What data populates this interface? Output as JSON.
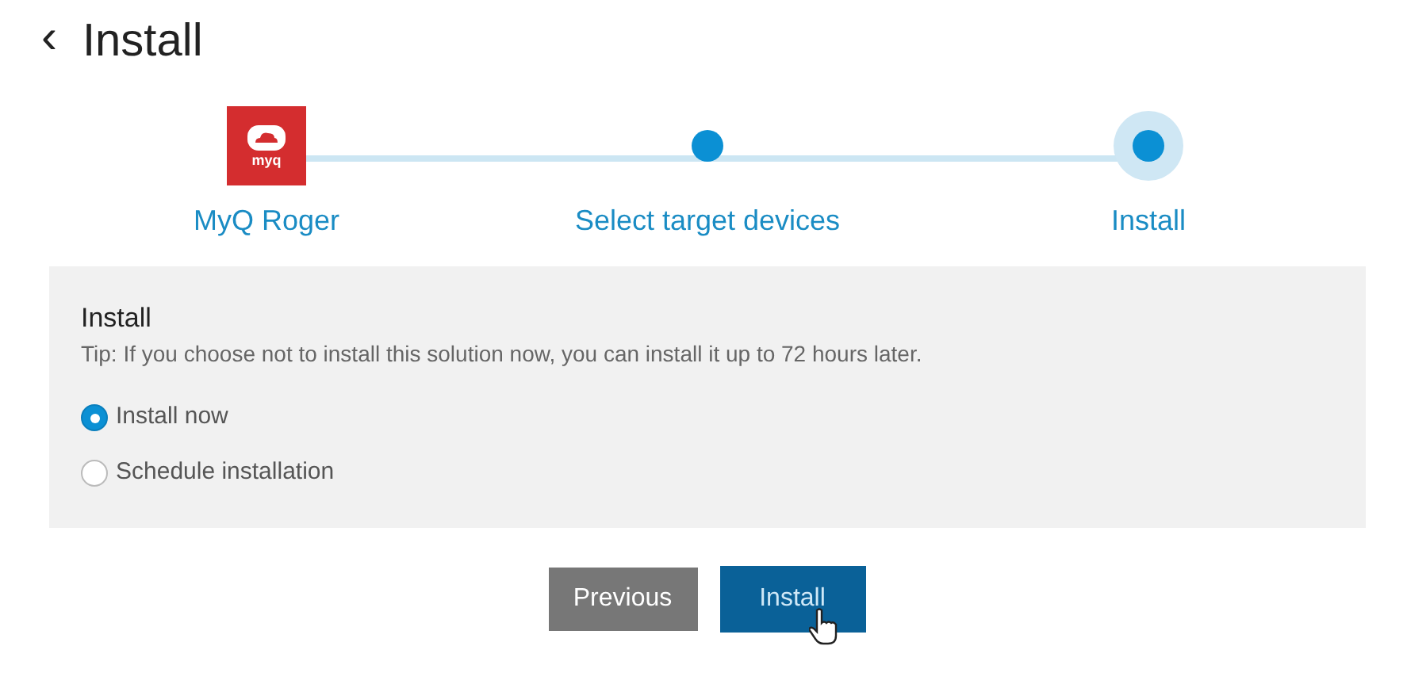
{
  "header": {
    "back_icon": "‹",
    "title": "Install"
  },
  "steps": [
    {
      "kind": "logo",
      "logo_text": "myq",
      "label": "MyQ Roger",
      "current": false
    },
    {
      "kind": "dot",
      "label": "Select target devices",
      "current": false
    },
    {
      "kind": "dot",
      "label": "Install",
      "current": true
    }
  ],
  "panel": {
    "title": "Install",
    "tip": "Tip: If you choose not to install this solution now, you can install it up to 72 hours later.",
    "options": [
      {
        "label": "Install now",
        "selected": true
      },
      {
        "label": "Schedule installation",
        "selected": false
      }
    ]
  },
  "buttons": [
    {
      "kind": "secondary",
      "label": "Previous",
      "hovered": false
    },
    {
      "kind": "primary",
      "label": "Install",
      "hovered": true
    }
  ]
}
